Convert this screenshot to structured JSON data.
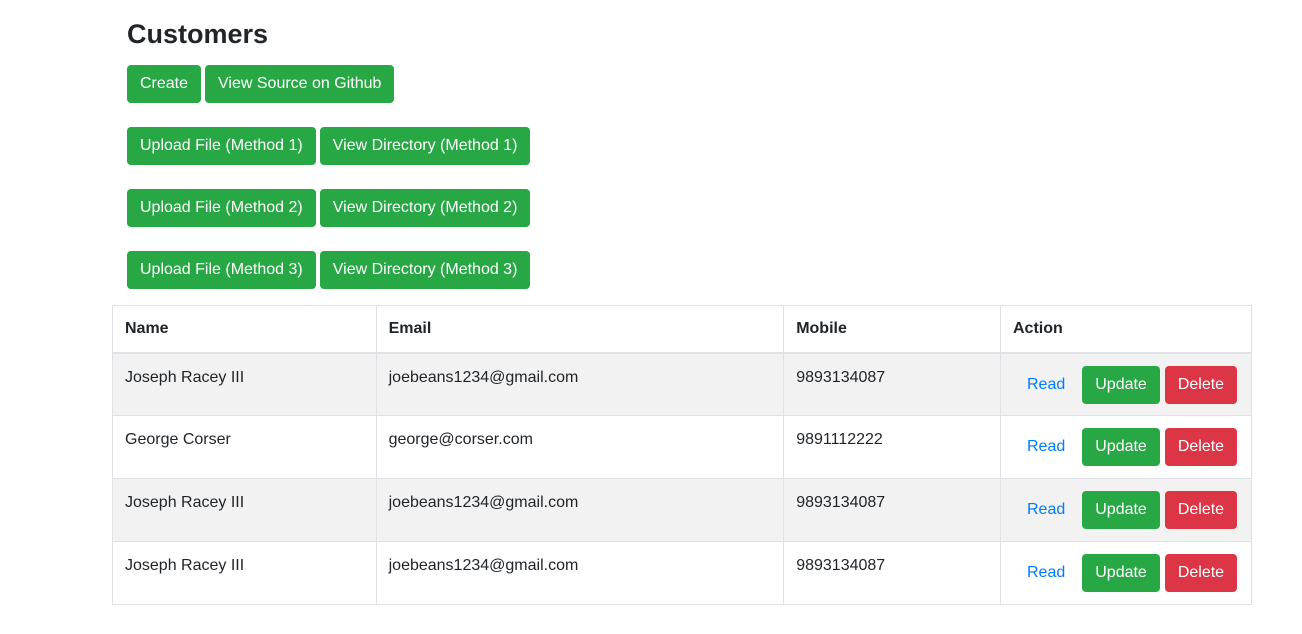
{
  "page": {
    "title": "Customers"
  },
  "buttons": {
    "create": "Create",
    "view_source": "View Source on Github",
    "upload_1": "Upload File (Method 1)",
    "view_dir_1": "View Directory (Method 1)",
    "upload_2": "Upload File (Method 2)",
    "view_dir_2": "View Directory (Method 2)",
    "upload_3": "Upload File (Method 3)",
    "view_dir_3": "View Directory (Method 3)"
  },
  "table": {
    "headers": {
      "name": "Name",
      "email": "Email",
      "mobile": "Mobile",
      "action": "Action"
    },
    "actions": {
      "read": "Read",
      "update": "Update",
      "delete": "Delete"
    },
    "rows": [
      {
        "name": "Joseph Racey III",
        "email": "joebeans1234@gmail.com",
        "mobile": "9893134087"
      },
      {
        "name": "George Corser",
        "email": "george@corser.com",
        "mobile": "9891112222"
      },
      {
        "name": "Joseph Racey III",
        "email": "joebeans1234@gmail.com",
        "mobile": "9893134087"
      },
      {
        "name": "Joseph Racey III",
        "email": "joebeans1234@gmail.com",
        "mobile": "9893134087"
      }
    ]
  },
  "colors": {
    "success": "#28a745",
    "danger": "#dc3545",
    "link": "#007bff",
    "stripe": "#f2f2f2",
    "border": "#dee2e6"
  }
}
